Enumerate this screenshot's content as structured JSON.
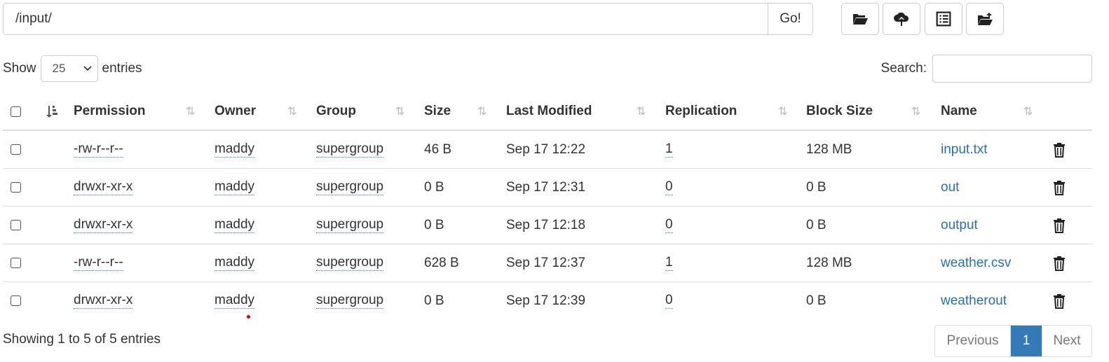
{
  "path": {
    "value": "/input/",
    "go_label": "Go!"
  },
  "toolbar": {
    "icons": [
      "open-folder-icon",
      "upload-cloud-icon",
      "list-view-icon",
      "move-folder-icon"
    ]
  },
  "length_menu": {
    "show_label": "Show",
    "selected": "25",
    "entries_label": "entries"
  },
  "search": {
    "label": "Search:",
    "value": ""
  },
  "table": {
    "headers": [
      "Permission",
      "Owner",
      "Group",
      "Size",
      "Last Modified",
      "Replication",
      "Block Size",
      "Name"
    ],
    "rows": [
      {
        "permission": "-rw-r--r--",
        "owner": "maddy",
        "group": "supergroup",
        "size": "46 B",
        "modified": "Sep 17 12:22",
        "replication": "1",
        "block_size": "128 MB",
        "name": "input.txt"
      },
      {
        "permission": "drwxr-xr-x",
        "owner": "maddy",
        "group": "supergroup",
        "size": "0 B",
        "modified": "Sep 17 12:31",
        "replication": "0",
        "block_size": "0 B",
        "name": "out"
      },
      {
        "permission": "drwxr-xr-x",
        "owner": "maddy",
        "group": "supergroup",
        "size": "0 B",
        "modified": "Sep 17 12:18",
        "replication": "0",
        "block_size": "0 B",
        "name": "output"
      },
      {
        "permission": "-rw-r--r--",
        "owner": "maddy",
        "group": "supergroup",
        "size": "628 B",
        "modified": "Sep 17 12:37",
        "replication": "1",
        "block_size": "128 MB",
        "name": "weather.csv"
      },
      {
        "permission": "drwxr-xr-x",
        "owner": "maddy",
        "group": "supergroup",
        "size": "0 B",
        "modified": "Sep 17 12:39",
        "replication": "0",
        "block_size": "0 B",
        "name": "weatherout"
      }
    ]
  },
  "footer": {
    "info": "Showing 1 to 5 of 5 entries",
    "previous": "Previous",
    "page": "1",
    "next": "Next"
  },
  "colors": {
    "link": "#2a6fb1",
    "active_page": "#337ab7"
  }
}
